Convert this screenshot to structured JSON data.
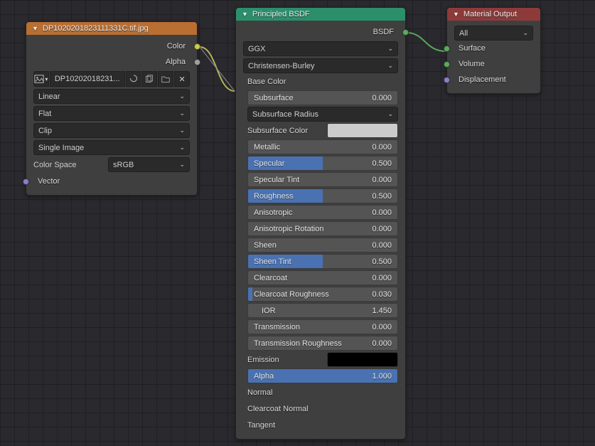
{
  "imageNode": {
    "title": "DP1020201823111331C.tif.jpg",
    "outputs": {
      "color": "Color",
      "alpha": "Alpha"
    },
    "texName": "DP10202018231...",
    "interp": "Linear",
    "projection": "Flat",
    "extension": "Clip",
    "source": "Single Image",
    "colorSpaceLabel": "Color Space",
    "colorSpace": "sRGB",
    "vector": "Vector"
  },
  "bsdfNode": {
    "title": "Principled BSDF",
    "outputLabel": "BSDF",
    "distribution": "GGX",
    "sssMethod": "Christensen-Burley",
    "props": [
      {
        "name": "Base Color",
        "type": "label",
        "sock": "yellow"
      },
      {
        "name": "Subsurface",
        "type": "slider",
        "value": "0.000",
        "fill": 0,
        "sock": "gray"
      },
      {
        "name": "Subsurface Radius",
        "type": "select",
        "sock": "purple"
      },
      {
        "name": "Subsurface Color",
        "type": "color",
        "color": "#cccccc",
        "sock": "yellow"
      },
      {
        "name": "Metallic",
        "type": "slider",
        "value": "0.000",
        "fill": 0,
        "sock": "gray"
      },
      {
        "name": "Specular",
        "type": "slider",
        "value": "0.500",
        "fill": 50,
        "sock": "gray"
      },
      {
        "name": "Specular Tint",
        "type": "slider",
        "value": "0.000",
        "fill": 0,
        "sock": "gray"
      },
      {
        "name": "Roughness",
        "type": "slider",
        "value": "0.500",
        "fill": 50,
        "sock": "gray"
      },
      {
        "name": "Anisotropic",
        "type": "slider",
        "value": "0.000",
        "fill": 0,
        "sock": "gray"
      },
      {
        "name": "Anisotropic Rotation",
        "type": "slider",
        "value": "0.000",
        "fill": 0,
        "sock": "gray"
      },
      {
        "name": "Sheen",
        "type": "slider",
        "value": "0.000",
        "fill": 0,
        "sock": "gray"
      },
      {
        "name": "Sheen Tint",
        "type": "slider",
        "value": "0.500",
        "fill": 50,
        "sock": "gray"
      },
      {
        "name": "Clearcoat",
        "type": "slider",
        "value": "0.000",
        "fill": 0,
        "sock": "gray"
      },
      {
        "name": "Clearcoat Roughness",
        "type": "slider",
        "value": "0.030",
        "fill": 3,
        "sock": "gray"
      },
      {
        "name": "IOR",
        "type": "slider",
        "value": "1.450",
        "fill": 0,
        "sock": "gray",
        "indent": true
      },
      {
        "name": "Transmission",
        "type": "slider",
        "value": "0.000",
        "fill": 0,
        "sock": "gray"
      },
      {
        "name": "Transmission Roughness",
        "type": "slider",
        "value": "0.000",
        "fill": 0,
        "sock": "gray"
      },
      {
        "name": "Emission",
        "type": "color",
        "color": "#000000",
        "sock": "yellow"
      },
      {
        "name": "Alpha",
        "type": "slider",
        "value": "1.000",
        "fill": 100,
        "sock": "gray"
      },
      {
        "name": "Normal",
        "type": "label",
        "sock": "purple"
      },
      {
        "name": "Clearcoat Normal",
        "type": "label",
        "sock": "purple"
      },
      {
        "name": "Tangent",
        "type": "label",
        "sock": "purple"
      }
    ]
  },
  "outputNode": {
    "title": "Material Output",
    "target": "All",
    "inputs": [
      {
        "name": "Surface",
        "sock": "green"
      },
      {
        "name": "Volume",
        "sock": "green"
      },
      {
        "name": "Displacement",
        "sock": "purple"
      }
    ]
  }
}
